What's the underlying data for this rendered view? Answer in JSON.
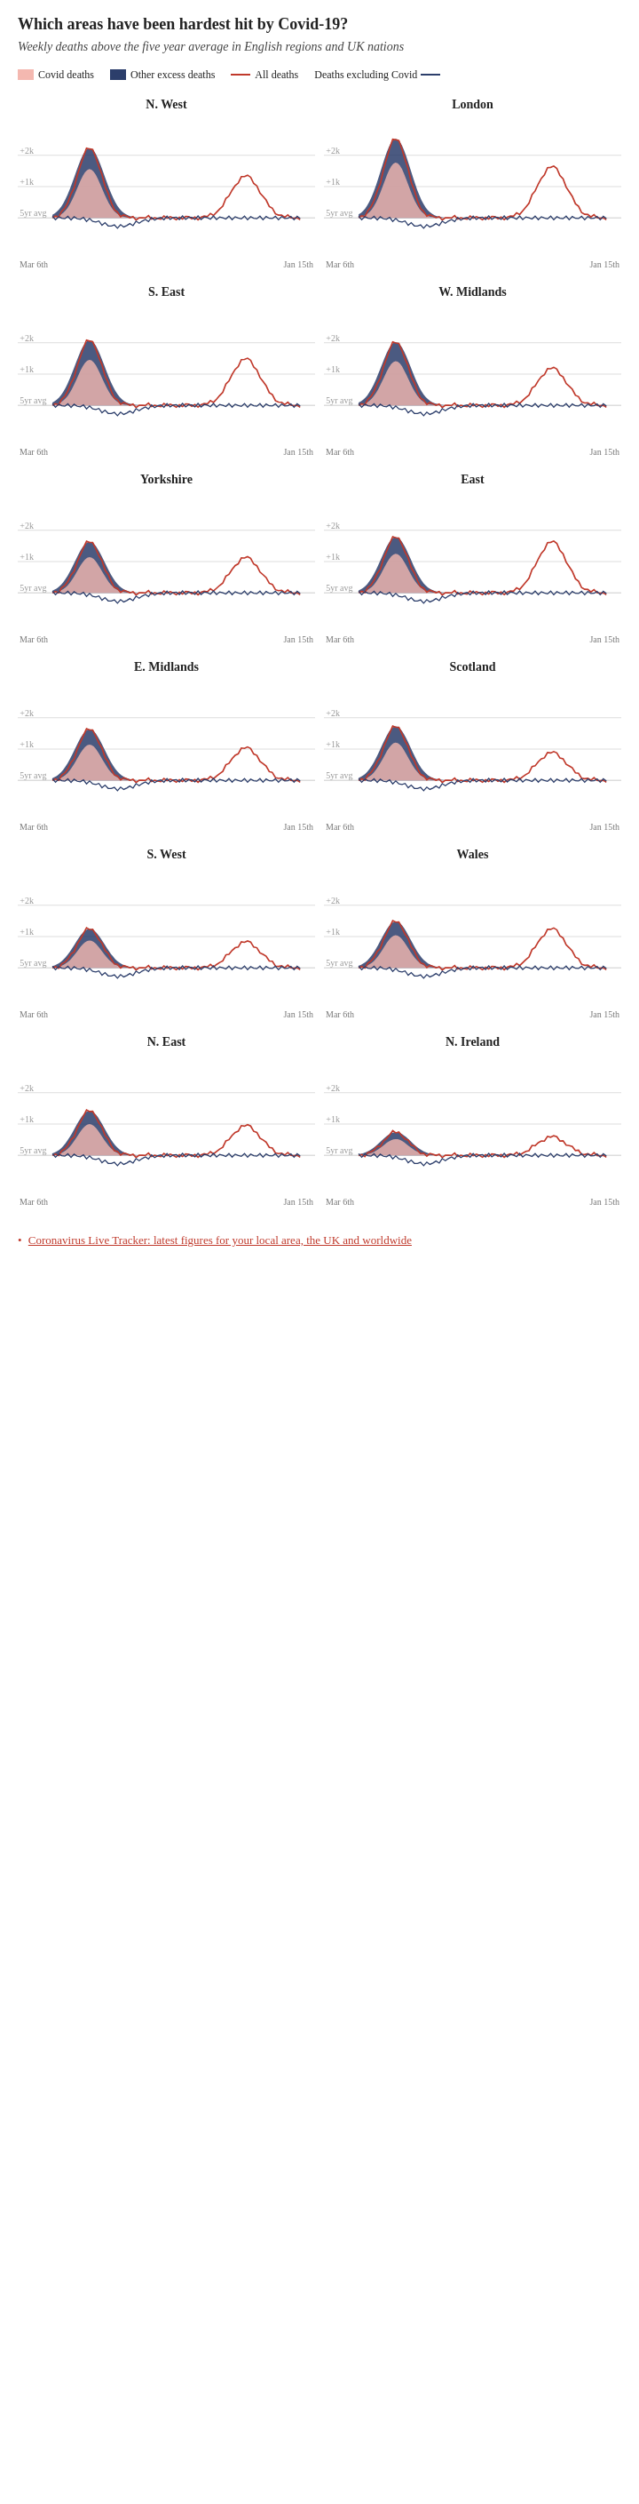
{
  "title": "Which areas have been hardest hit by Covid-19?",
  "subtitle": "Weekly deaths above the five year average in English regions and UK nations",
  "legend": {
    "items": [
      {
        "type": "swatch",
        "color": "#f4b8b0",
        "label": "Covid deaths"
      },
      {
        "type": "swatch",
        "color": "#2c3e6b",
        "label": "Other excess deaths"
      },
      {
        "type": "line",
        "color": "#c0392b",
        "label": "All deaths"
      },
      {
        "type": "line",
        "color": "#2c3e6b",
        "label": "Deaths excluding Covid"
      }
    ]
  },
  "y_labels": [
    "+2k",
    "+1k",
    "5yr avg"
  ],
  "x_labels": [
    "Mar 6th",
    "Jan 15th"
  ],
  "charts": [
    {
      "id": "n-west",
      "title": "N. West",
      "peak_height": 0.75,
      "second_peak": 0.45
    },
    {
      "id": "london",
      "title": "London",
      "peak_height": 0.85,
      "second_peak": 0.55
    },
    {
      "id": "s-east",
      "title": "S. East",
      "peak_height": 0.7,
      "second_peak": 0.5
    },
    {
      "id": "w-midlands",
      "title": "W. Midlands",
      "peak_height": 0.68,
      "second_peak": 0.4
    },
    {
      "id": "yorkshire",
      "title": "Yorkshire",
      "peak_height": 0.55,
      "second_peak": 0.38
    },
    {
      "id": "east",
      "title": "East",
      "peak_height": 0.6,
      "second_peak": 0.55
    },
    {
      "id": "e-midlands",
      "title": "E. Midlands",
      "peak_height": 0.55,
      "second_peak": 0.35
    },
    {
      "id": "scotland",
      "title": "Scotland",
      "peak_height": 0.58,
      "second_peak": 0.3
    },
    {
      "id": "s-west",
      "title": "S. West",
      "peak_height": 0.42,
      "second_peak": 0.28
    },
    {
      "id": "wales",
      "title": "Wales",
      "peak_height": 0.5,
      "second_peak": 0.42
    },
    {
      "id": "n-east",
      "title": "N. East",
      "peak_height": 0.48,
      "second_peak": 0.32
    },
    {
      "id": "n-ireland",
      "title": "N. Ireland",
      "peak_height": 0.25,
      "second_peak": 0.2
    }
  ],
  "footer": {
    "link_text": "Coronavirus Live Tracker: latest figures for your local area, the UK and worldwide",
    "link_href": "#"
  }
}
